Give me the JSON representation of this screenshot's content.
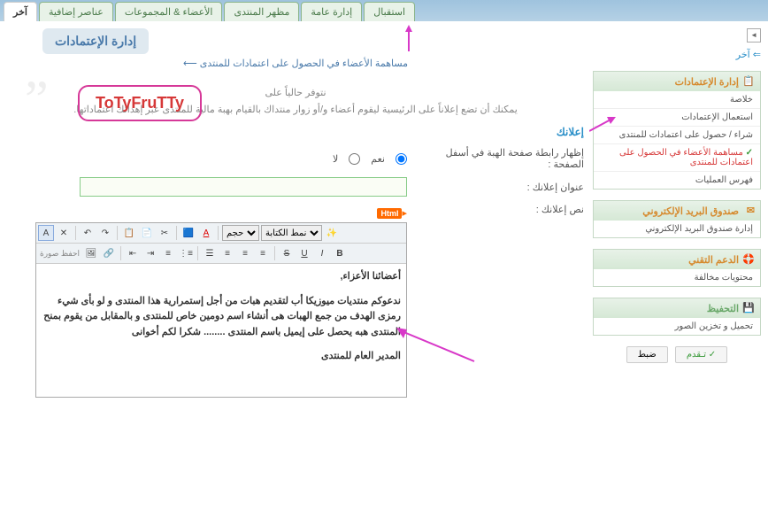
{
  "tabs": {
    "t0": "استقبال",
    "t1": "إدارة عامة",
    "t2": "مظهر المنتدى",
    "t3": "الأعضاء & المجموعات",
    "t4": "عناصر إضافية",
    "t5": "آخر"
  },
  "back": "⇐ آخر",
  "sidebar": {
    "p1": {
      "title": "إدارة الإعتمادات",
      "i0": "خلاصة",
      "i1": "استعمال الإعتمادات",
      "i2": "شراء / حصول على اعتمادات للمنتدى",
      "i3": "مساهمة الأعضاء في الحصول على اعتمادات للمنتدى",
      "i4": "فهرس العمليات"
    },
    "p2": {
      "title": "صندوق البريد الإلكتروني",
      "i0": "إدارة صندوق البريد الإلكتروني"
    },
    "p3": {
      "title": "الدعم التقني",
      "i0": "محتويات مخالفة"
    },
    "p4": {
      "title": "التحفيظ",
      "i0": "تحميل و تخزين الصور"
    },
    "btn_save": "تـقدم",
    "btn_reset": "ضبط"
  },
  "page": {
    "title": "إدارة الإعتمادات",
    "subtitle": "مساهمة الأعضاء في الحصول على اعتمادات للمنتدى",
    "brand": "ToTyFruTTy",
    "wm1": "نتوفر حالياً على",
    "wm2": "يمكنك أن تضع إعلاناً على الرئيسية ليقوم أعضاء و/أو زوار منتداك بالقيام بهبة مالية للمنتدى عبر إهدائك اعتماداتها."
  },
  "form": {
    "section": "إعلانك",
    "lbl_show": "إظهار رابطة صفحة الهبة في أسفل الصفحة :",
    "opt_yes": "نعم",
    "opt_no": "لا",
    "lbl_title": "عنوان إعلانك :",
    "lbl_text": "نص إعلانك :",
    "html_badge": "Html",
    "font_style": "نمط الكتابة",
    "img_upload": "احفظ صورة",
    "content_p1": "أعضائنا الأعزاء,",
    "content_p2": "ندعوكم منتديات ميوزيكا أب لتقديم هبات من أجل إستمرارية هذا المنتدى و لو بأى شيء رمزى الهدف من جمع الهبات هى أنشاء اسم دومين خاص للمنتدى و بالمقابل من يقوم بمنح المنتدى هبه يحصل على إيميل باسم المنتدى ........ شكرا لكم أخوانى",
    "content_p3": "المدير العام للمنتدى"
  }
}
